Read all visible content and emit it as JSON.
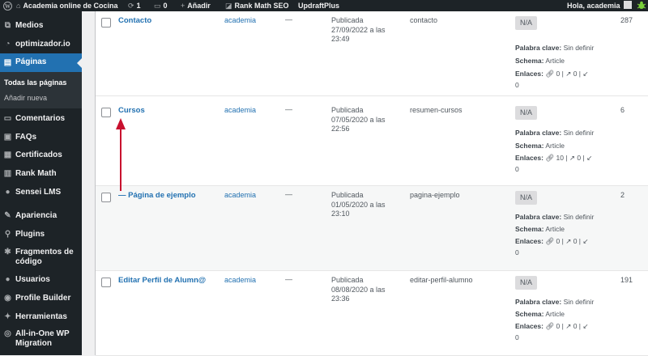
{
  "admin_bar": {
    "site_name": "Academia online de Cocina",
    "updates_count": "1",
    "comments_count": "0",
    "add_new": "Añadir",
    "rank_math": "Rank Math SEO",
    "updraftplus": "UpdraftPlus",
    "greeting": "Hola, academia"
  },
  "sidebar": {
    "items": [
      {
        "label": "Medios",
        "icon": "media-icon"
      },
      {
        "label": "optimizador.io",
        "icon": "gauge-icon"
      },
      {
        "label": "Páginas",
        "icon": "pages-icon"
      },
      {
        "label": "Comentarios",
        "icon": "comments-icon"
      },
      {
        "label": "FAQs",
        "icon": "faq-icon"
      },
      {
        "label": "Certificados",
        "icon": "certificate-icon"
      },
      {
        "label": "Rank Math",
        "icon": "chart-icon"
      },
      {
        "label": "Sensei LMS",
        "icon": "sensei-icon"
      },
      {
        "label": "Apariencia",
        "icon": "brush-icon"
      },
      {
        "label": "Plugins",
        "icon": "plugin-icon"
      },
      {
        "label": "Fragmentos de código",
        "icon": "wrench-icon"
      },
      {
        "label": "Usuarios",
        "icon": "users-icon"
      },
      {
        "label": "Profile Builder",
        "icon": "profile-icon"
      },
      {
        "label": "Herramientas",
        "icon": "tools-icon"
      },
      {
        "label": "All-in-One WP Migration",
        "icon": "migration-icon"
      }
    ],
    "submenu": [
      "Todas las páginas",
      "Añadir nueva"
    ]
  },
  "rows": [
    {
      "title": "Contacto",
      "author": "academia",
      "comments": "—",
      "status": "Publicada",
      "date": "27/09/2022 a las",
      "time": "23:49",
      "slug": "contacto",
      "badge": "N/A",
      "keyword_label": "Palabra clave:",
      "keyword": "Sin definir",
      "schema_label": "Schema:",
      "schema": "Article",
      "links_label": "Enlaces:",
      "internal": "0",
      "external": "0",
      "incoming": "0",
      "count": "287"
    },
    {
      "title": "Cursos",
      "author": "academia",
      "comments": "—",
      "status": "Publicada",
      "date": "07/05/2020 a las",
      "time": "22:56",
      "slug": "resumen-cursos",
      "badge": "N/A",
      "keyword_label": "Palabra clave:",
      "keyword": "Sin definir",
      "schema_label": "Schema:",
      "schema": "Article",
      "links_label": "Enlaces:",
      "internal": "10",
      "external": "0",
      "incoming": "0",
      "count": "6"
    },
    {
      "title": "— Página de ejemplo",
      "author": "academia",
      "comments": "—",
      "status": "Publicada",
      "date": "01/05/2020 a las",
      "time": "23:10",
      "slug": "pagina-ejemplo",
      "badge": "N/A",
      "keyword_label": "Palabra clave:",
      "keyword": "Sin definir",
      "schema_label": "Schema:",
      "schema": "Article",
      "links_label": "Enlaces:",
      "internal": "0",
      "external": "0",
      "incoming": "0",
      "count": "2"
    },
    {
      "title": "Editar Perfil de Alumn@",
      "author": "academia",
      "comments": "—",
      "status": "Publicada",
      "date": "08/08/2020 a las",
      "time": "23:36",
      "slug": "editar-perfil-alumno",
      "badge": "N/A",
      "keyword_label": "Palabra clave:",
      "keyword": "Sin definir",
      "schema_label": "Schema:",
      "schema": "Article",
      "links_label": "Enlaces:",
      "internal": "0",
      "external": "0",
      "incoming": "0",
      "count": "191"
    }
  ],
  "colors": {
    "accent": "#2271b1",
    "annotation_arrow": "#c8102e",
    "sidebar_bg": "#1d2327"
  }
}
